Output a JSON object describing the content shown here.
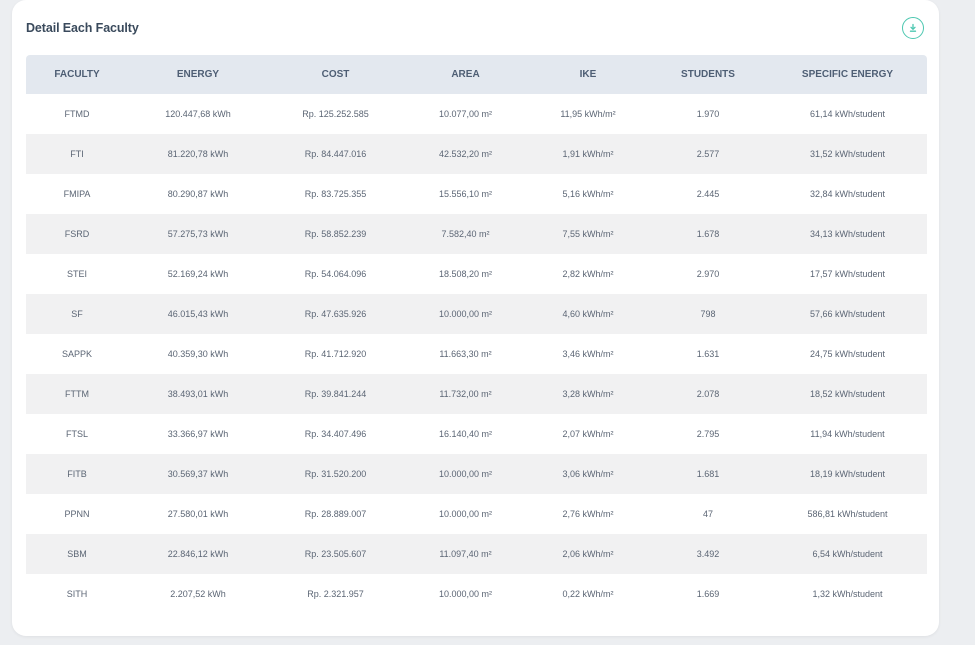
{
  "card": {
    "title": "Detail Each Faculty"
  },
  "colors": {
    "accent": "#4cc7b0",
    "header_bg": "#e3e8ef",
    "row_alt_bg": "#f1f1f2"
  },
  "table": {
    "headers": [
      "FACULTY",
      "ENERGY",
      "COST",
      "AREA",
      "IKE",
      "STUDENTS",
      "SPECIFIC ENERGY"
    ],
    "rows": [
      [
        "FTMD",
        "120.447,68 kWh",
        "Rp. 125.252.585",
        "10.077,00 m²",
        "11,95 kWh/m²",
        "1.970",
        "61,14 kWh/student"
      ],
      [
        "FTI",
        "81.220,78 kWh",
        "Rp. 84.447.016",
        "42.532,20 m²",
        "1,91 kWh/m²",
        "2.577",
        "31,52 kWh/student"
      ],
      [
        "FMIPA",
        "80.290,87 kWh",
        "Rp. 83.725.355",
        "15.556,10 m²",
        "5,16 kWh/m²",
        "2.445",
        "32,84 kWh/student"
      ],
      [
        "FSRD",
        "57.275,73 kWh",
        "Rp. 58.852.239",
        "7.582,40 m²",
        "7,55 kWh/m²",
        "1.678",
        "34,13 kWh/student"
      ],
      [
        "STEI",
        "52.169,24 kWh",
        "Rp. 54.064.096",
        "18.508,20 m²",
        "2,82 kWh/m²",
        "2.970",
        "17,57 kWh/student"
      ],
      [
        "SF",
        "46.015,43 kWh",
        "Rp. 47.635.926",
        "10.000,00 m²",
        "4,60 kWh/m²",
        "798",
        "57,66 kWh/student"
      ],
      [
        "SAPPK",
        "40.359,30 kWh",
        "Rp. 41.712.920",
        "11.663,30 m²",
        "3,46 kWh/m²",
        "1.631",
        "24,75 kWh/student"
      ],
      [
        "FTTM",
        "38.493,01 kWh",
        "Rp. 39.841.244",
        "11.732,00 m²",
        "3,28 kWh/m²",
        "2.078",
        "18,52 kWh/student"
      ],
      [
        "FTSL",
        "33.366,97 kWh",
        "Rp. 34.407.496",
        "16.140,40 m²",
        "2,07 kWh/m²",
        "2.795",
        "11,94 kWh/student"
      ],
      [
        "FITB",
        "30.569,37 kWh",
        "Rp. 31.520.200",
        "10.000,00 m²",
        "3,06 kWh/m²",
        "1.681",
        "18,19 kWh/student"
      ],
      [
        "PPNN",
        "27.580,01 kWh",
        "Rp. 28.889.007",
        "10.000,00 m²",
        "2,76 kWh/m²",
        "47",
        "586,81 kWh/student"
      ],
      [
        "SBM",
        "22.846,12 kWh",
        "Rp. 23.505.607",
        "11.097,40 m²",
        "2,06 kWh/m²",
        "3.492",
        "6,54 kWh/student"
      ],
      [
        "SITH",
        "2.207,52 kWh",
        "Rp. 2.321.957",
        "10.000,00 m²",
        "0,22 kWh/m²",
        "1.669",
        "1,32 kWh/student"
      ]
    ]
  },
  "icons": {
    "download": "download-icon"
  }
}
